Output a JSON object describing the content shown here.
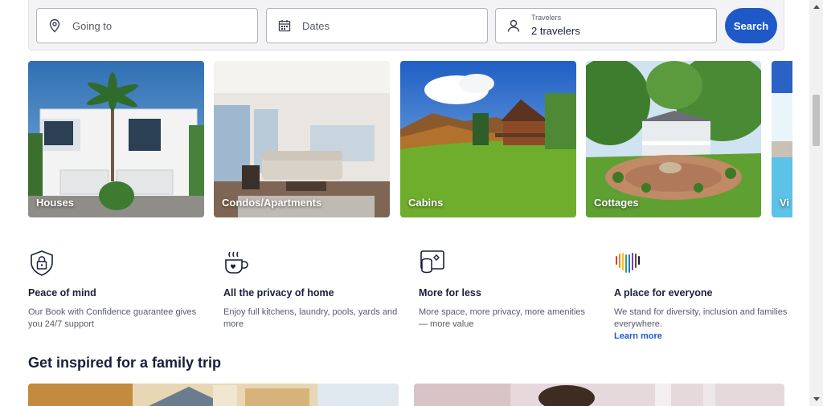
{
  "search": {
    "going_to_placeholder": "Going to",
    "dates_placeholder": "Dates",
    "travelers_label": "Travelers",
    "travelers_value": "2 travelers",
    "search_label": "Search"
  },
  "property_types": [
    {
      "label": "Houses"
    },
    {
      "label": "Condos/Apartments"
    },
    {
      "label": "Cabins"
    },
    {
      "label": "Cottages"
    },
    {
      "label": "Vi"
    }
  ],
  "features": [
    {
      "icon": "lock-shield-icon",
      "title": "Peace of mind",
      "description": "Our Book with Confidence guarantee gives you 24/7 support"
    },
    {
      "icon": "coffee-cup-icon",
      "title": "All the privacy of home",
      "description": "Enjoy full kitchens, laundry, pools, yards and more"
    },
    {
      "icon": "coins-icon",
      "title": "More for less",
      "description": "More space, more privacy, more amenities — more value"
    },
    {
      "icon": "rainbow-heart-icon",
      "title": "A place for everyone",
      "description": "We stand for diversity, inclusion and families everywhere.",
      "link": "Learn more"
    }
  ],
  "section": {
    "title": "Get inspired for a family trip"
  },
  "colors": {
    "accent": "#1f58c7",
    "text": "#191e3b",
    "muted": "#575a6b"
  }
}
